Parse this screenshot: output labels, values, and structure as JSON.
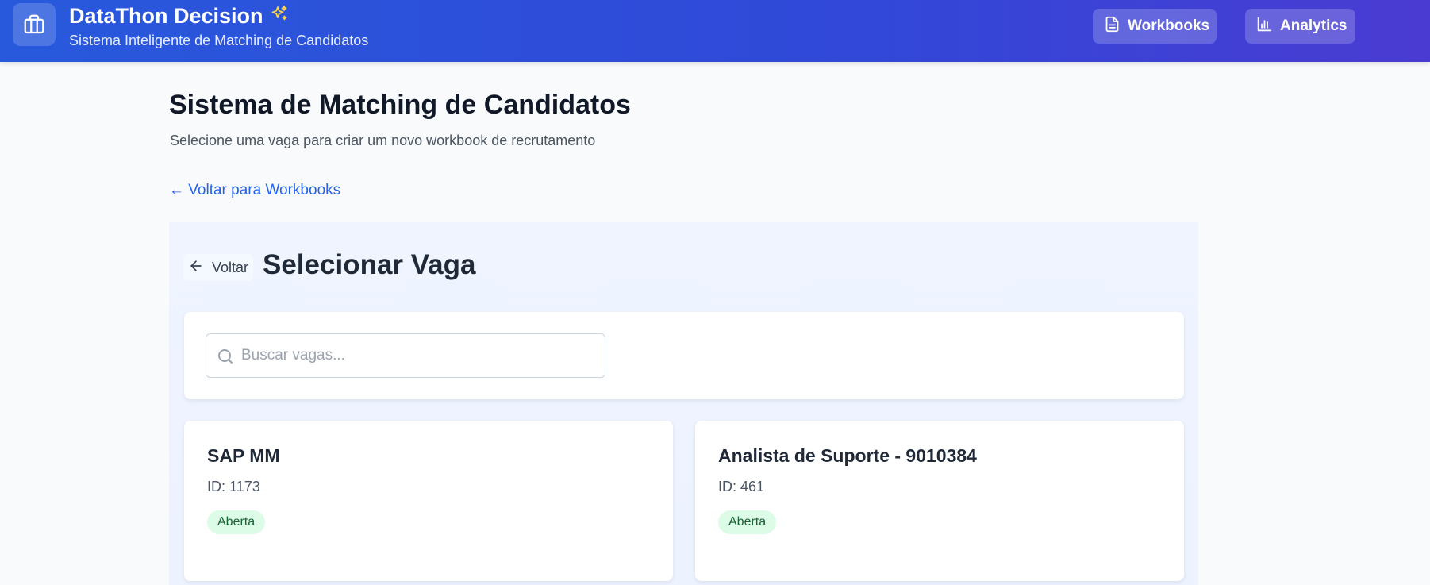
{
  "header": {
    "app_title": "DataThon Decision",
    "app_subtitle": "Sistema Inteligente de Matching de Candidatos",
    "nav": [
      {
        "label": "Workbooks",
        "icon": "document-icon"
      },
      {
        "label": "Analytics",
        "icon": "bar-chart-icon"
      }
    ],
    "logo_icon": "briefcase-icon",
    "title_icon": "sparkles-icon"
  },
  "page": {
    "title": "Sistema de Matching de Candidatos",
    "subtitle": "Selecione uma vaga para criar um novo workbook de recrutamento",
    "back_link": "← Voltar para Workbooks"
  },
  "panel": {
    "back_button": "Voltar",
    "title": "Selecionar Vaga",
    "search": {
      "placeholder": "Buscar vagas...",
      "value": ""
    }
  },
  "jobs": [
    {
      "title": "SAP MM",
      "id_label": "ID: 1173",
      "status": "Aberta"
    },
    {
      "title": "Analista de Suporte - 9010384",
      "id_label": "ID: 461",
      "status": "Aberta"
    }
  ],
  "colors": {
    "header_gradient_start": "#2859dc",
    "header_gradient_end": "#4a3bd2",
    "link": "#2563eb",
    "badge_bg": "#dcfce7",
    "badge_text": "#166534"
  }
}
